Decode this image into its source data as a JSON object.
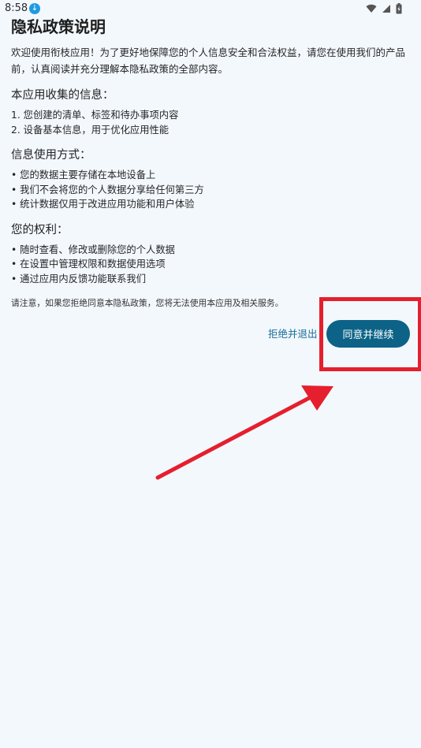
{
  "status_bar": {
    "time": "8:58",
    "download_icon": "download-icon",
    "icons": [
      "wifi-icon",
      "signal-icon",
      "battery-icon"
    ]
  },
  "page": {
    "title": "隐私政策说明",
    "intro": "欢迎使用衔枝应用！为了更好地保障您的个人信息安全和合法权益，请您在使用我们的产品前，认真阅读并充分理解本隐私政策的全部内容。",
    "sections": [
      {
        "title": "本应用收集的信息：",
        "items": [
          "1. 您创建的清单、标签和待办事项内容",
          "2. 设备基本信息，用于优化应用性能"
        ]
      },
      {
        "title": "信息使用方式：",
        "items": [
          "• 您的数据主要存储在本地设备上",
          "• 我们不会将您的个人数据分享给任何第三方",
          "• 统计数据仅用于改进应用功能和用户体验"
        ]
      },
      {
        "title": "您的权利：",
        "items": [
          "• 随时查看、修改或删除您的个人数据",
          "• 在设置中管理权限和数据使用选项",
          "• 通过应用内反馈功能联系我们"
        ]
      }
    ],
    "notice": "请注意，如果您拒绝同意本隐私政策，您将无法使用本应用及相关服务。"
  },
  "actions": {
    "reject_label": "拒绝并退出",
    "agree_label": "同意并继续"
  },
  "colors": {
    "background": "#f3f8fd",
    "primary_button": "#0c6387",
    "link": "#1a6d9a",
    "annotation": "#e51f2d"
  }
}
